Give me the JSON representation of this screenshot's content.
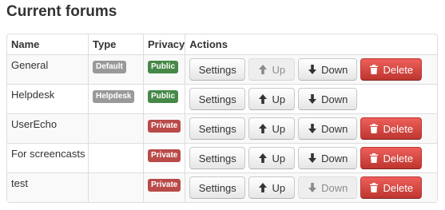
{
  "title": "Current forums",
  "headers": {
    "name": "Name",
    "type": "Type",
    "privacy": "Privacy",
    "actions": "Actions"
  },
  "buttons": {
    "settings": "Settings",
    "up": "Up",
    "down": "Down",
    "delete": "Delete"
  },
  "colors": {
    "default_badge": "#999999",
    "public_badge": "#468847",
    "private_badge": "#b94a48",
    "danger": "#da4f49"
  },
  "rows": [
    {
      "name": "General",
      "type": "Default",
      "privacy": "Public"
    },
    {
      "name": "Helpdesk",
      "type": "Helpdesk",
      "privacy": "Public"
    },
    {
      "name": "UserEcho",
      "type": "",
      "privacy": "Private"
    },
    {
      "name": "For screencasts",
      "type": "",
      "privacy": "Private"
    },
    {
      "name": "test",
      "type": "",
      "privacy": "Private"
    }
  ]
}
